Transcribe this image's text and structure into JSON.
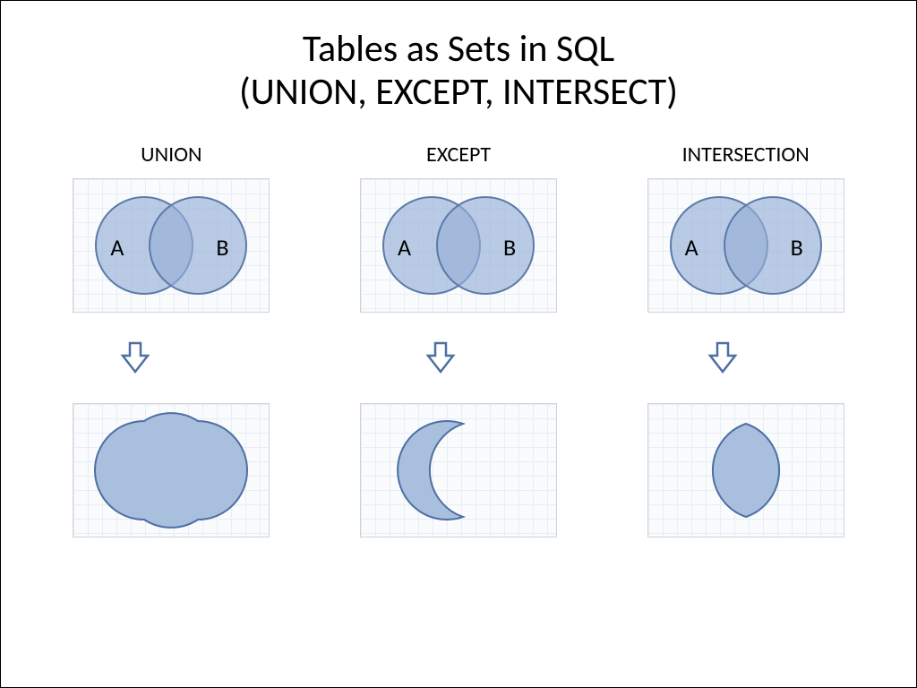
{
  "title_line1": "Tables as Sets in SQL",
  "title_line2": "(UNION, EXCEPT, INTERSECT)",
  "columns": [
    {
      "label": "UNION",
      "left": "A",
      "right": "B"
    },
    {
      "label": "EXCEPT",
      "left": "A",
      "right": "B"
    },
    {
      "label": "INTERSECTION",
      "left": "A",
      "right": "B"
    }
  ],
  "colors": {
    "shape_fill": "#a9bfde",
    "shape_stroke": "#4e6fa3",
    "arrow_stroke": "#4e6fa3",
    "arrow_fill": "#ffffff"
  }
}
